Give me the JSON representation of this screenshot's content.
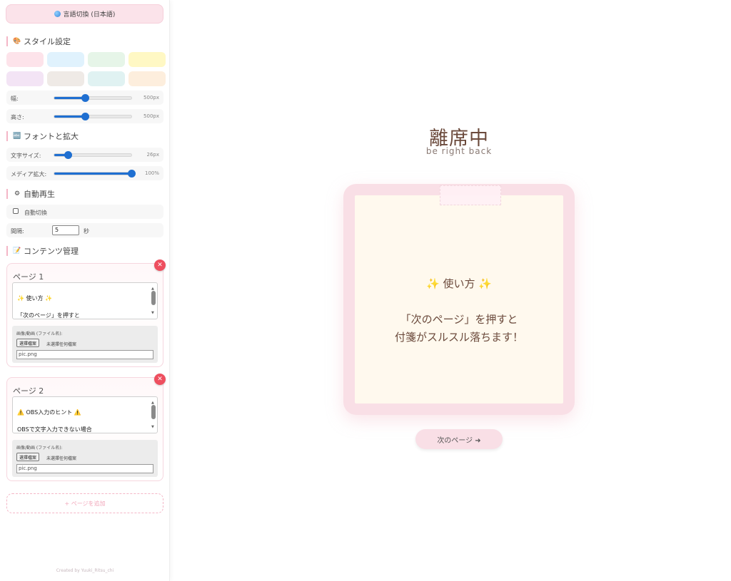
{
  "sidebar": {
    "lang_button": "言語切換 (日本語)",
    "style_title": "スタイル設定",
    "swatches": [
      "#fde3ea",
      "#e0f2fd",
      "#e6f5e8",
      "#fff8c4",
      "#f3e4f5",
      "#efeae6",
      "#e0f2f2",
      "#fdeedd"
    ],
    "width_label": "幅:",
    "width_value": "500px",
    "width_level": 0.4,
    "height_label": "高さ:",
    "height_value": "500px",
    "height_level": 0.4,
    "font_title": "フォントと拡大",
    "fontsize_label": "文字サイズ:",
    "fontsize_value": "26px",
    "fontsize_level": 0.18,
    "media_label": "メディア拡大:",
    "media_value": "100%",
    "media_level": 1.0,
    "auto_title": "自動再生",
    "auto_switch_label": "自動切換",
    "interval_label": "間隔:",
    "interval_value": "5",
    "interval_unit": "秒",
    "content_title": "コンテンツ管理",
    "pages": [
      {
        "title": "ページ 1",
        "text": "✨ 使い方 ✨\n\n「次のページ」を押すと\n付箋がスルスル落ちます！",
        "media_label": "画像/動画 (ファイル名):",
        "file_button": "選擇檔案",
        "file_none": "未選擇任何檔案",
        "filename": "pic.png"
      },
      {
        "title": "ページ 2",
        "text": "⚠️ OBS入力のヒント ⚠️\n\nOBSで文字入力できない場合\n一度メモ帳などで作成してから",
        "media_label": "画像/動画 (ファイル名):",
        "file_button": "選擇檔案",
        "file_none": "未選擇任何檔案",
        "filename": "pic.png"
      }
    ],
    "add_page": "+ ページを追加",
    "credit": "Created by Yuuki_Ritsu_chi"
  },
  "main": {
    "title": "離席中",
    "subtitle": "be right back",
    "note_text": "✨ 使い方 ✨\n\n「次のページ」を押すと\n付箋がスルスル落ちます！",
    "next_button": "次のページ ➜"
  }
}
